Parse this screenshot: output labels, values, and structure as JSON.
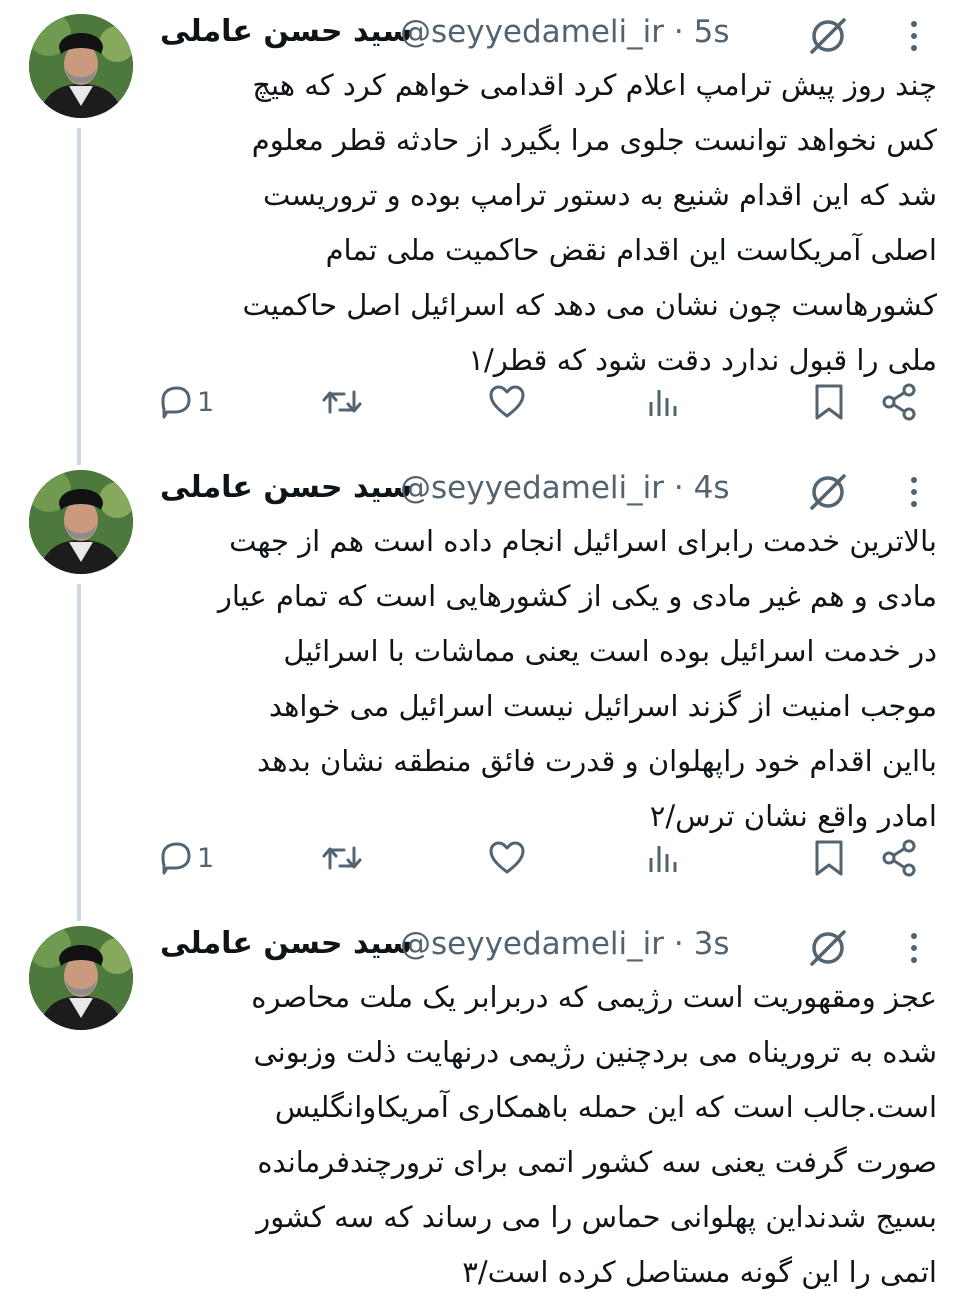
{
  "tweets": [
    {
      "author_name": "سید حسن عاملی",
      "handle": "@seyyedameli_ir",
      "separator": "·",
      "time": "5s",
      "text": "چند روز پیش ترامپ اعلام کرد اقدامی خواهم کرد که هیچ\nکس نخواهد توانست جلوی مرا بگیرد از حادثه قطر معلوم\nشد که این اقدام شنیع به دستور ترامپ بوده و تروریست\nاصلی آمریکاست این اقدام نقض حاکمیت ملی تمام\nکشورهاست چون نشان می دهد که اسرائیل اصل حاکمیت\nملی را قبول ندارد دقت شود که قطر/۱",
      "reply_count": "1"
    },
    {
      "author_name": "سید حسن عاملی",
      "handle": "@seyyedameli_ir",
      "separator": "·",
      "time": "4s",
      "text": "بالاترین خدمت رابرای اسرائیل انجام داده است هم از جهت\nمادی و هم غیر مادی و یکی از کشورهایی است که تمام عیار\nدر خدمت اسرائیل بوده است یعنی مماشات با اسرائیل\nموجب امنیت از گزند اسرائیل نیست اسرائیل می خواهد\nبااین اقدام خود راپهلوان و قدرت فائق منطقه نشان بدهد\nامادر واقع نشان ترس/۲",
      "reply_count": "1"
    },
    {
      "author_name": "سید حسن عاملی",
      "handle": "@seyyedameli_ir",
      "separator": "·",
      "time": "3s",
      "text": "عجز ومقهوریت است رژیمی که دربرابر یک ملت محاصره\nشده به تروریناه می بردچنین رژیمی درنهایت ذلت وزبونی\nاست.جالب است که این حمله باهمکاری آمریکاوانگلیس\nصورت گرفت یعنی سه کشور اتمی برای ترورچندفرمانده\nبسیج شدنداین پهلوانی حماس را می رساند که سه کشور\nاتمی را این گونه مستاصل کرده است/۳",
      "reply_count": ""
    }
  ],
  "colors": {
    "text": "#0f1419",
    "secondary": "#536471",
    "thread_line": "#cfd9de",
    "background": "#ffffff"
  },
  "icons": {
    "reply": "reply-icon",
    "retweet": "retweet-icon",
    "like": "heart-icon",
    "views": "views-icon",
    "bookmark": "bookmark-icon",
    "share": "share-icon",
    "grok": "grok-icon",
    "more": "more-icon"
  }
}
